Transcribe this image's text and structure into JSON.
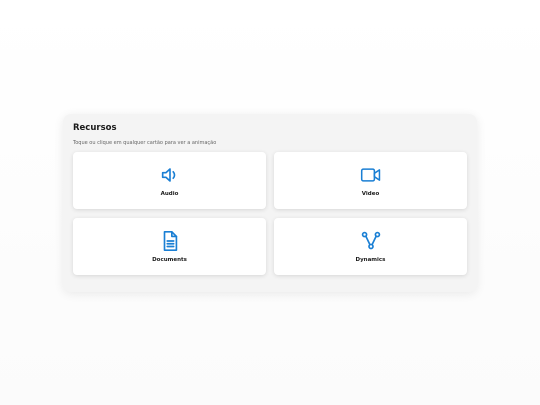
{
  "panel": {
    "title": "Recursos",
    "subtitle": "Toque ou clique em qualquer cartão para ver a animação"
  },
  "cards": [
    {
      "label": "Audio",
      "icon": "speaker-icon"
    },
    {
      "label": "Video",
      "icon": "video-camera-icon"
    },
    {
      "label": "Documents",
      "icon": "document-icon"
    },
    {
      "label": "Dynamics",
      "icon": "network-icon"
    }
  ],
  "colors": {
    "accent": "#1a7fd4",
    "panel_bg": "#f4f4f4",
    "card_bg": "#ffffff",
    "text": "#1a1a1a"
  }
}
